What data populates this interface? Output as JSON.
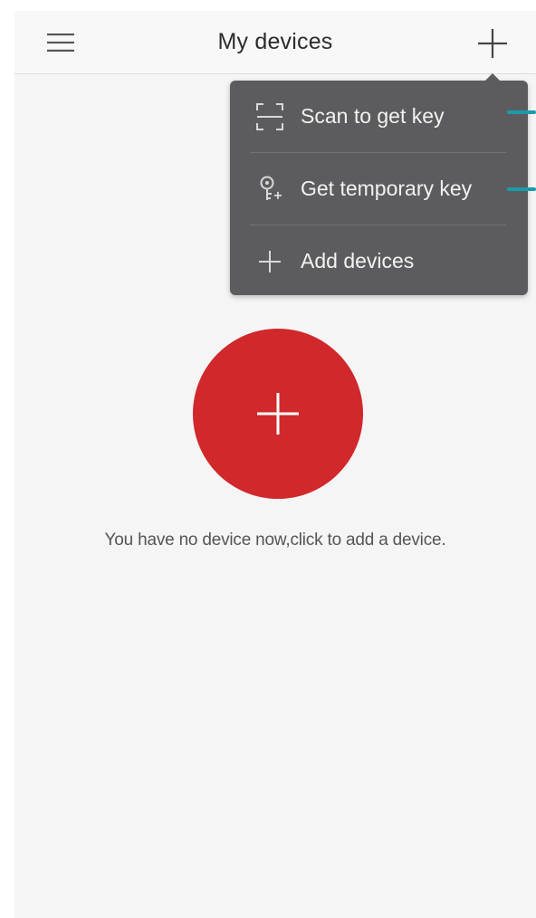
{
  "header": {
    "title": "My devices",
    "menu_icon": "hamburger-menu-icon",
    "add_icon": "plus-icon"
  },
  "popup_menu": {
    "items": [
      {
        "label": "Scan to get key",
        "icon": "scan-frame-icon"
      },
      {
        "label": "Get temporary key",
        "icon": "temporary-key-icon"
      },
      {
        "label": "Add devices",
        "icon": "plus-icon"
      }
    ]
  },
  "empty_state": {
    "message": "You have no device now,click to add a device.",
    "add_button_icon": "plus-icon"
  },
  "colors": {
    "accent_red": "#d0282b",
    "popup_background": "#5c5c5e",
    "indicator_teal": "#1a9ba8",
    "screen_background": "#f5f5f6"
  }
}
